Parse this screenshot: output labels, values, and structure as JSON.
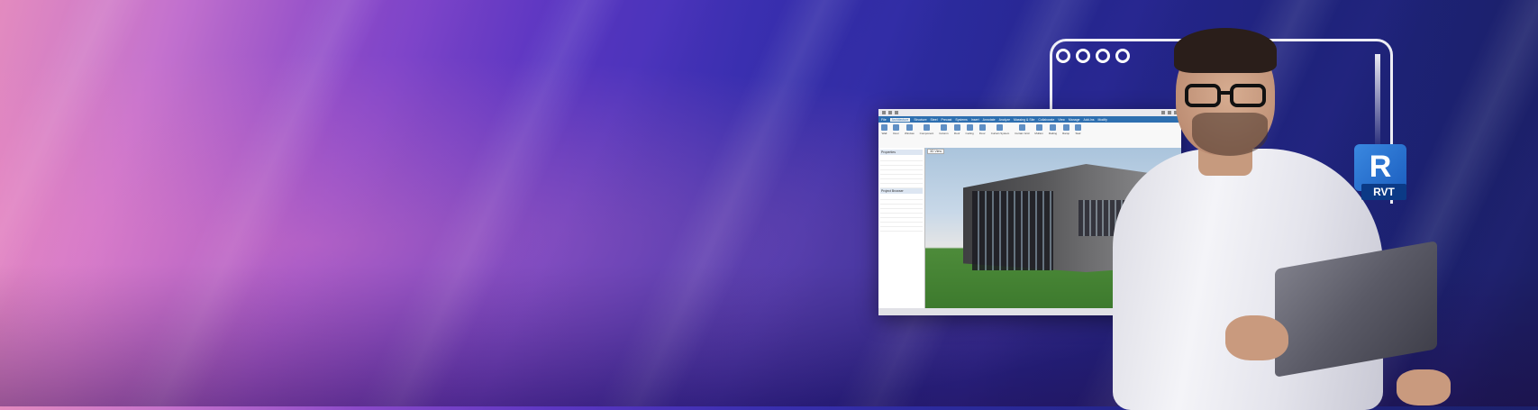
{
  "banner": {
    "app_window": {
      "title": "",
      "ribbon_tabs": [
        "File",
        "Architecture",
        "Structure",
        "Steel",
        "Precast",
        "Systems",
        "Insert",
        "Annotate",
        "Analyze",
        "Massing & Site",
        "Collaborate",
        "View",
        "Manage",
        "Add-Ins",
        "Modify"
      ],
      "active_tab": "Architecture",
      "ribbon_groups": [
        "Wall",
        "Door",
        "Window",
        "Component",
        "Column",
        "Roof",
        "Ceiling",
        "Floor",
        "Curtain System",
        "Curtain Grid",
        "Mullion",
        "Railing",
        "Ramp",
        "Stair"
      ],
      "properties_header": "Properties",
      "browser_header": "Project Browser",
      "view_tab": "3D View",
      "status_text": ""
    },
    "badge": {
      "letter": "R",
      "label": "RVT"
    }
  }
}
